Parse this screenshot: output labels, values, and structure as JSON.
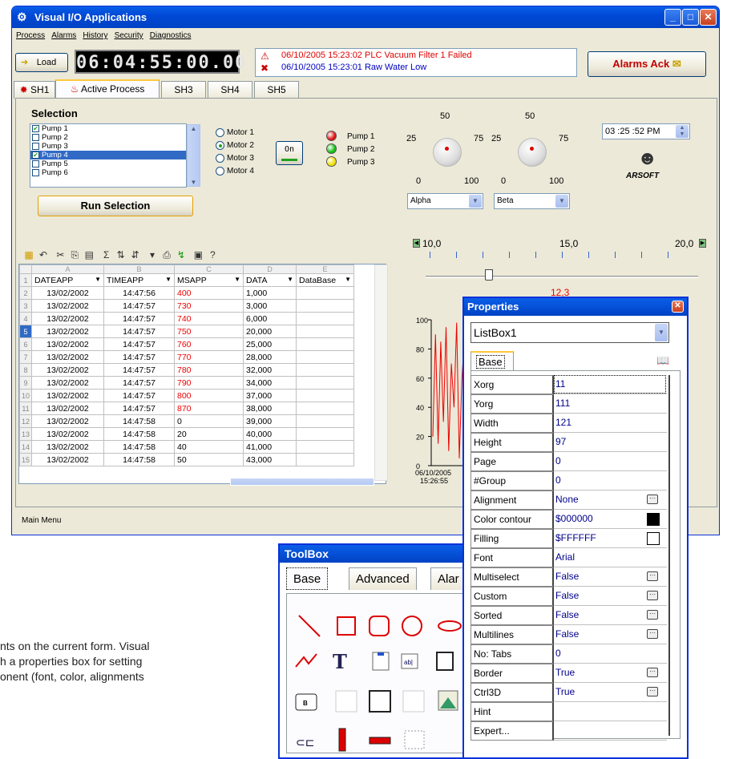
{
  "window": {
    "title": "Visual I/O Applications",
    "menu": [
      "Process",
      "Alarms",
      "History",
      "Security",
      "Diagnostics"
    ],
    "load_label": "Load",
    "clock": "06:04:55:00.00",
    "alarms": [
      {
        "time": "06/10/2005 15:23:02",
        "text": "PLC Vacuum Filter 1 Failed",
        "color": "#e00000"
      },
      {
        "time": "06/10/2005 15:23:01",
        "text": "Raw Water Low",
        "color": "#0000c0"
      }
    ],
    "alarms_ack_label": "Alarms Ack",
    "tabs": [
      "SH1",
      "Active Process",
      "SH3",
      "SH4",
      "SH5"
    ],
    "status_bar": "Main Menu"
  },
  "selection": {
    "title": "Selection",
    "list": [
      {
        "label": "Pump 1",
        "checked": true,
        "selected": false
      },
      {
        "label": "Pump 2",
        "checked": false,
        "selected": false
      },
      {
        "label": "Pump 3",
        "checked": false,
        "selected": false
      },
      {
        "label": "Pump 4",
        "checked": true,
        "selected": true
      },
      {
        "label": "Pump 5",
        "checked": false,
        "selected": false
      },
      {
        "label": "Pump 6",
        "checked": false,
        "selected": false
      }
    ],
    "motors": [
      "Motor 1",
      "Motor 2",
      "Motor 3",
      "Motor 4"
    ],
    "motor_selected": 1,
    "on_label": "On",
    "pumps": [
      {
        "label": "Pump 1",
        "color": "#e01010"
      },
      {
        "label": "Pump 2",
        "color": "#10c010"
      },
      {
        "label": "Pump 3",
        "color": "#f0e000"
      }
    ],
    "run_label": "Run Selection"
  },
  "knobs": {
    "scale": {
      "min": "0",
      "q1": "25",
      "mid": "50",
      "q3": "75",
      "max": "100"
    },
    "combo1": "Alpha",
    "combo2": "Beta"
  },
  "time_picker": "03 :25 :52 PM",
  "logo_text": "ARSOFT",
  "slider": {
    "labels": [
      "10,0",
      "15,0",
      "20,0"
    ],
    "value": "12,3"
  },
  "grid": {
    "columns": [
      "A",
      "B",
      "C",
      "D",
      "E"
    ],
    "headers": [
      "DATEAPP",
      "TIMEAPP",
      "MSAPP",
      "DATA",
      "DataBase"
    ],
    "rows": [
      [
        "13/02/2002",
        "14:47:56",
        "400",
        "1,000",
        ""
      ],
      [
        "13/02/2002",
        "14:47:57",
        "730",
        "3,000",
        ""
      ],
      [
        "13/02/2002",
        "14:47:57",
        "740",
        "6,000",
        ""
      ],
      [
        "13/02/2002",
        "14:47:57",
        "750",
        "20,000",
        ""
      ],
      [
        "13/02/2002",
        "14:47:57",
        "760",
        "25,000",
        ""
      ],
      [
        "13/02/2002",
        "14:47:57",
        "770",
        "28,000",
        ""
      ],
      [
        "13/02/2002",
        "14:47:57",
        "780",
        "32,000",
        ""
      ],
      [
        "13/02/2002",
        "14:47:57",
        "790",
        "34,000",
        ""
      ],
      [
        "13/02/2002",
        "14:47:57",
        "800",
        "37,000",
        ""
      ],
      [
        "13/02/2002",
        "14:47:57",
        "870",
        "38,000",
        ""
      ],
      [
        "13/02/2002",
        "14:47:58",
        "0",
        "39,000",
        ""
      ],
      [
        "13/02/2002",
        "14:47:58",
        "20",
        "40,000",
        ""
      ],
      [
        "13/02/2002",
        "14:47:58",
        "40",
        "41,000",
        ""
      ],
      [
        "13/02/2002",
        "14:47:58",
        "50",
        "43,000",
        ""
      ]
    ],
    "red_rows": [
      0,
      1,
      2,
      3,
      4,
      5,
      6,
      7,
      8,
      9
    ],
    "selected_row": 3
  },
  "chart": {
    "yticks": [
      "100",
      "80",
      "60",
      "40",
      "20",
      "0"
    ],
    "xlabel1": "06/10/2005",
    "xlabel2": "15:26:55"
  },
  "properties": {
    "title": "Properties",
    "object": "ListBox1",
    "tab": "Base",
    "rows": [
      {
        "k": "Xorg",
        "v": "11",
        "btn": false
      },
      {
        "k": "Yorg",
        "v": "111",
        "btn": false
      },
      {
        "k": "Width",
        "v": "121",
        "btn": false
      },
      {
        "k": "Height",
        "v": "97",
        "btn": false
      },
      {
        "k": "Page",
        "v": "0",
        "btn": false
      },
      {
        "k": "#Group",
        "v": "0",
        "btn": false
      },
      {
        "k": "Alignment",
        "v": "None",
        "btn": true
      },
      {
        "k": "Color contour",
        "v": "$000000",
        "btn": false
      },
      {
        "k": "Filling",
        "v": "$FFFFFF",
        "btn": false
      },
      {
        "k": "Font",
        "v": "Arial",
        "btn": false
      },
      {
        "k": "Multiselect",
        "v": "False",
        "btn": true
      },
      {
        "k": "Custom",
        "v": "False",
        "btn": true
      },
      {
        "k": "Sorted",
        "v": "False",
        "btn": true
      },
      {
        "k": "Multilines",
        "v": "False",
        "btn": true
      },
      {
        "k": "No: Tabs",
        "v": "0",
        "btn": false
      },
      {
        "k": "Border",
        "v": "True",
        "btn": true
      },
      {
        "k": "Ctrl3D",
        "v": "True",
        "btn": true
      },
      {
        "k": "Hint",
        "v": "",
        "btn": false
      },
      {
        "k": "Expert...",
        "v": "",
        "btn": false
      }
    ]
  },
  "toolbox": {
    "title": "ToolBox",
    "tabs": [
      "Base",
      "Advanced",
      "Alar"
    ]
  },
  "caption": [
    "nts on the current form. Visual",
    "h a properties box for setting",
    "onent (font, color, alignments"
  ]
}
